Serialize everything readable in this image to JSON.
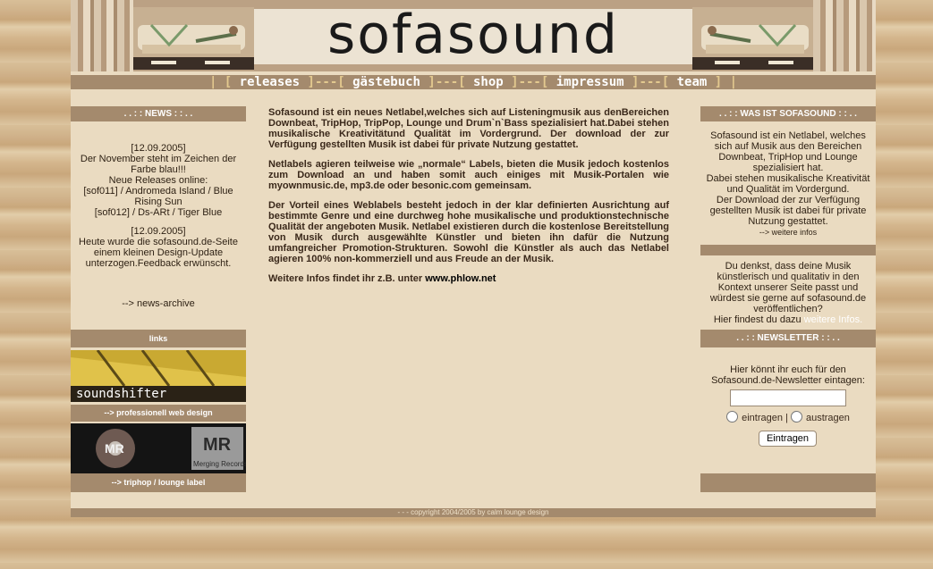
{
  "header": {
    "logo_text": "sofasound"
  },
  "nav": {
    "items": [
      "releases",
      "gästebuch",
      "shop",
      "impressum",
      "team"
    ]
  },
  "left": {
    "news_title": ". . : : NEWS : : . .",
    "news": [
      {
        "date": "[12.09.2005]",
        "lines": [
          "Der November steht im Zeichen der",
          "Farbe blau!!!",
          "Neue Releases online:",
          "[sof011] / Andromeda Island / Blue",
          "Rising Sun",
          "[sof012] / Ds-ARt / Tiger Blue"
        ]
      },
      {
        "date": "[12.09.2005]",
        "lines": [
          "Heute wurde die sofasound.de-Seite",
          "einem kleinen Design-Update",
          "unterzogen.Feedback erwünscht."
        ]
      }
    ],
    "archive_link": "--> news-archive",
    "links_title": "links",
    "banner1_text": "soundshifter",
    "banner1_caption": "--> professionell web design",
    "banner2_text_a": "MR",
    "banner2_text_b": "Merging Records",
    "banner2_caption": "--> triphop / lounge label"
  },
  "main": {
    "paragraphs": [
      "Sofasound ist ein neues Netlabel,welches sich auf Listeningmusik aus denBereichen Downbeat, TripHop, TripPop, Lounge und Drum`n`Bass spezialisiert hat.Dabei stehen musikalische Kreativitätund Qualität im Vordergrund. Der download der zur Verfügung gestellten Musik ist dabei für private Nutzung gestattet.",
      "Netlabels agieren teilweise wie „normale“ Labels, bieten die Musik jedoch kostenlos zum Download an und haben somit auch einiges mit Musik-Portalen wie myownmusic.de, mp3.de oder besonic.com gemeinsam.",
      "Der Vorteil eines Weblabels besteht jedoch in der klar definierten Ausrichtung auf bestimmte Genre und eine durchweg hohe musikalische und produktionstechnische Qualität der angeboten Musik. Netlabel existieren durch die kostenlose Bereitstellung von Musik durch ausgewählte Künstler und bieten ihn dafür die Nutzung umfangreicher Promotion-Strukturen. Sowohl die Künstler als auch das Netlabel agieren 100% non-kommerziell und aus Freude an der Musik."
    ],
    "more_prefix": "Weitere Infos findet ihr z.B. unter ",
    "more_link": "www.phlow.net"
  },
  "right": {
    "about_title": ". . : : WAS IST SOFASOUND : : . .",
    "about_lines": [
      "Sofasound ist ein Netlabel, welches",
      "sich auf Musik aus den Bereichen",
      "Downbeat, TripHop und Lounge",
      "spezialisiert hat.",
      "Dabei stehen musikalische Kreativität",
      "und Qualität im Vordergund.",
      "Der Download der zur Verfügung",
      "gestellten Musik ist dabei für private",
      "Nutzung gestattet."
    ],
    "about_more": "--> weitere infos",
    "submit_lines": [
      "Du denkst, dass deine Musik",
      "künstlerisch und qualitativ in den",
      "Kontext unserer Seite passt und",
      "würdest sie gerne auf sofasound.de",
      "veröffentlichen?"
    ],
    "submit_prefix": "Hier findest du dazu ",
    "submit_link": "weitere Infos.",
    "newsletter_title": ". . : : NEWSLETTER : : . .",
    "newsletter_lines": [
      "Hier könnt ihr euch für den",
      "Sofasound.de-Newsletter eintagen:"
    ],
    "email_value": "",
    "radio_subscribe": "eintragen",
    "radio_sep": "|",
    "radio_unsubscribe": "austragen",
    "submit_button": "Eintragen"
  },
  "footer": {
    "text": "- - - copyright 2004/2005 by calm lounge design"
  }
}
